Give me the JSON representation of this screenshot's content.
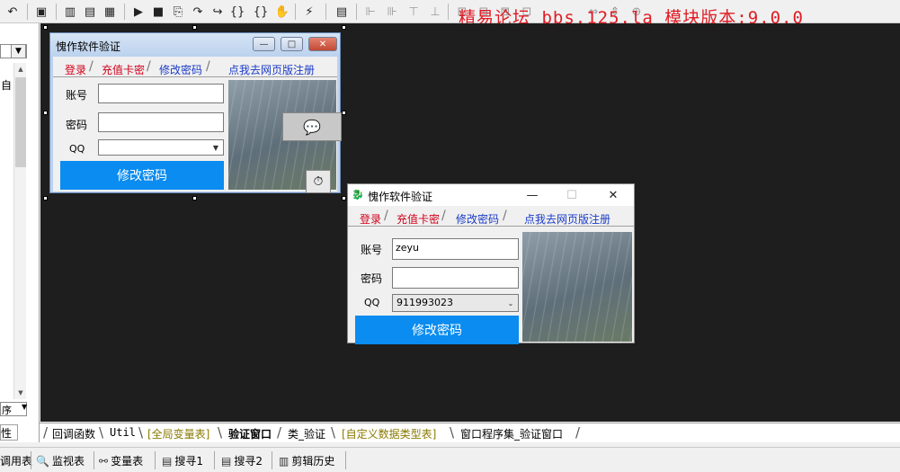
{
  "toolbar": {
    "icons": [
      "undo-icon",
      "layout-a-icon",
      "layout-b-icon",
      "layout-c-icon",
      "run-icon",
      "stop-icon",
      "step-icon",
      "step-into-icon",
      "step-out-icon",
      "braces-icon",
      "hand-icon",
      "debug-icon",
      "form-icon",
      "align-left-icon",
      "align-center-icon",
      "align-top-icon",
      "align-mid-icon",
      "size-a-icon",
      "size-b-icon",
      "size-c-icon",
      "size-d-icon",
      "size-e-icon",
      "size-f-icon"
    ],
    "overlay_text": "精易论坛 bbs.125.la 模块版本:9.0.0"
  },
  "left_panel": {
    "row_char": "自",
    "order_label": "序",
    "property_tab": "性"
  },
  "design_window": {
    "title": "愧作软件验证",
    "cap_min": "—",
    "cap_max": "□",
    "cap_close": "✕",
    "tabs": [
      "登录",
      "充值卡密",
      "修改密码"
    ],
    "link": "点我去网页版注册",
    "label_account": "账号",
    "label_password": "密码",
    "label_qq": "QQ",
    "account_value": "",
    "password_value": "",
    "qq_value": "",
    "submit": "修改密码",
    "overlay_icon_a": "💬",
    "overlay_icon_b": "⏱"
  },
  "runtime_window": {
    "title": "愧作软件验证",
    "cap_min": "—",
    "cap_max": "☐",
    "cap_close": "✕",
    "tabs": [
      "登录",
      "充值卡密",
      "修改密码"
    ],
    "link": "点我去网页版注册",
    "label_account": "账号",
    "label_password": "密码",
    "label_qq": "QQ",
    "account_value": "zeyu",
    "password_value": "",
    "qq_value": "911993023",
    "submit": "修改密码"
  },
  "code_tabs": [
    {
      "label": "回调函数",
      "style": "normal"
    },
    {
      "label": "Util",
      "style": "normal"
    },
    {
      "label": "[全局变量表]",
      "style": "olive"
    },
    {
      "label": "验证窗口",
      "style": "active"
    },
    {
      "label": "类_验证",
      "style": "normal"
    },
    {
      "label": "[自定义数据类型表]",
      "style": "olive"
    },
    {
      "label": "窗口程序集_验证窗口",
      "style": "normal"
    }
  ],
  "status_tabs": [
    {
      "label": "调用表",
      "icon": "call-table-icon"
    },
    {
      "label": "监视表",
      "icon": "watch-icon"
    },
    {
      "label": "变量表",
      "icon": "variable-icon"
    },
    {
      "label": "搜寻1",
      "icon": "search1-icon"
    },
    {
      "label": "搜寻2",
      "icon": "search2-icon"
    },
    {
      "label": "剪辑历史",
      "icon": "clip-history-icon"
    }
  ]
}
